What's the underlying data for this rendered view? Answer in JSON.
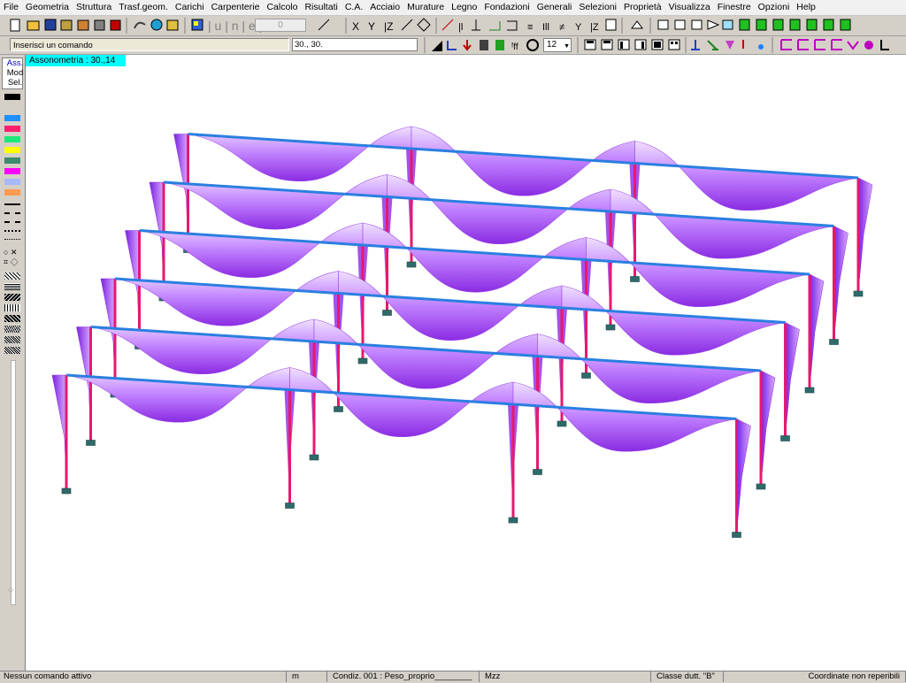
{
  "menu": [
    "File",
    "Geometria",
    "Struttura",
    "Trasf.geom.",
    "Carichi",
    "Carpenterie",
    "Calcolo",
    "Risultati",
    "C.A.",
    "Acciaio",
    "Murature",
    "Legno",
    "Fondazioni",
    "Generali",
    "Selezioni",
    "Proprietà",
    "Visualizza",
    "Finestre",
    "Opzioni",
    "Help"
  ],
  "toolbar": {
    "command_placeholder": "Inserisci un comando",
    "zero_value": "0",
    "coordinate_value": "30., 30.",
    "font_size_value": "12"
  },
  "left_panel": {
    "mode_buttons": [
      "Ass.",
      "Mod",
      "Sel."
    ],
    "palette": [
      "#000000",
      "#1e90ff",
      "#ff1e6e",
      "#1ee878",
      "#ffff00",
      "#3c8c6e",
      "#ff00ff",
      "#a8b8ff",
      "#ff9a50"
    ]
  },
  "view": {
    "label": "Assonometria :  30.,14"
  },
  "colors": {
    "beam": "#2b7fe0",
    "column": "#e8186e",
    "diagram": "#a050f0",
    "base": "#2e6a6a",
    "label_bg": "#00ffff"
  },
  "status": {
    "command": "Nessun comando attivo",
    "unit": "m",
    "condition": "Condiz. 001 : Peso_proprio________",
    "component": "Mzz",
    "class": "Classe dutt. \"B\"",
    "coords": "Coordinate non reperibili"
  }
}
